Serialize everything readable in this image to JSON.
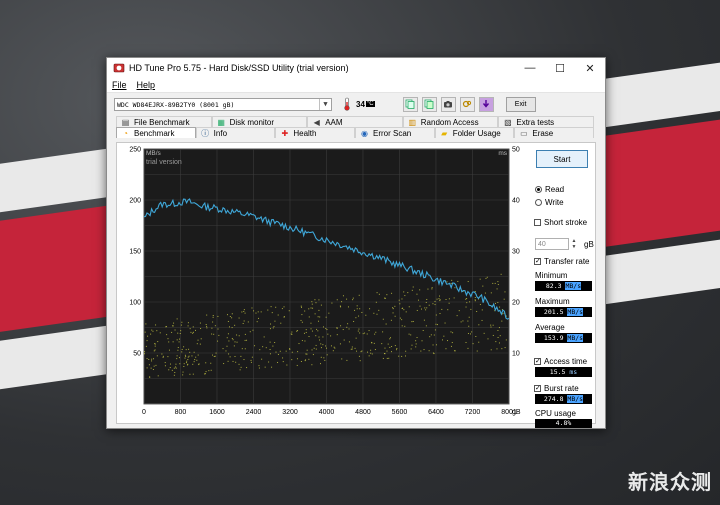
{
  "window": {
    "title": "HD Tune Pro 5.75 - Hard Disk/SSD Utility (trial version)",
    "controls": {
      "minimize": "—",
      "maximize": "☐",
      "close": "✕"
    }
  },
  "menu": {
    "file": "File",
    "help": "Help"
  },
  "toolbar": {
    "drive": "WDC WD84EJRX-89B2TY0 (8001 gB)",
    "temperature": "34",
    "temperature_unit": "°C",
    "exit_label": "Exit"
  },
  "tabs": {
    "row1": [
      {
        "label": "File Benchmark",
        "icon": "file-benchmark-icon"
      },
      {
        "label": "Disk monitor",
        "icon": "disk-monitor-icon"
      },
      {
        "label": "AAM",
        "icon": "speaker-icon"
      },
      {
        "label": "Random Access",
        "icon": "random-access-icon"
      },
      {
        "label": "Extra tests",
        "icon": "extra-tests-icon"
      }
    ],
    "row2": [
      {
        "label": "Benchmark",
        "icon": "benchmark-icon"
      },
      {
        "label": "Info",
        "icon": "info-icon"
      },
      {
        "label": "Health",
        "icon": "health-icon"
      },
      {
        "label": "Error Scan",
        "icon": "error-scan-icon"
      },
      {
        "label": "Folder Usage",
        "icon": "folder-icon"
      },
      {
        "label": "Erase",
        "icon": "erase-icon"
      }
    ],
    "active": "Benchmark"
  },
  "panel": {
    "start": "Start",
    "read": "Read",
    "write": "Write",
    "short_stroke": "Short stroke",
    "short_stroke_value": "40",
    "short_stroke_unit": "gB",
    "transfer_rate": "Transfer rate",
    "minimum_label": "Minimum",
    "minimum_value": "82.3",
    "maximum_label": "Maximum",
    "maximum_value": "201.5",
    "average_label": "Average",
    "average_value": "153.9",
    "rate_unit": "MB/s",
    "access_time_label": "Access time",
    "access_time_value": "15.5",
    "access_time_unit": "ms",
    "burst_rate_label": "Burst rate",
    "burst_rate_value": "274.8",
    "cpu_usage_label": "CPU usage",
    "cpu_usage_value": "4.8%"
  },
  "chart_data": {
    "type": "line",
    "overlay_text": "trial version",
    "y_left_label": "MB/s",
    "y_right_label": "ms",
    "x_unit": "gB",
    "y_left_ticks": [
      50,
      100,
      150,
      200,
      250
    ],
    "y_right_ticks": [
      10,
      20,
      30,
      40,
      50
    ],
    "x_ticks": [
      0,
      800,
      1600,
      2400,
      3200,
      4000,
      4800,
      5600,
      6400,
      7200,
      8001
    ],
    "ylim_left": [
      0,
      250
    ],
    "ylim_right": [
      0,
      50
    ],
    "xlim": [
      0,
      8001
    ],
    "series": [
      {
        "name": "Transfer rate",
        "color": "#3fa7d8",
        "x": [
          0,
          200,
          400,
          600,
          800,
          1000,
          1200,
          1400,
          1600,
          1800,
          2000,
          2200,
          2400,
          2600,
          2800,
          3000,
          3200,
          3400,
          3600,
          3800,
          4000,
          4200,
          4400,
          4600,
          4800,
          5000,
          5200,
          5400,
          5600,
          5800,
          6000,
          6200,
          6400,
          6600,
          6800,
          7000,
          7200,
          7400,
          7600,
          7800,
          8001
        ],
        "y": [
          182,
          190,
          196,
          196,
          198,
          198,
          195,
          193,
          192,
          190,
          188,
          186,
          184,
          181,
          178,
          176,
          173,
          170,
          167,
          164,
          161,
          158,
          155,
          152,
          149,
          146,
          143,
          139,
          136,
          133,
          129,
          126,
          122,
          119,
          115,
          111,
          108,
          104,
          97,
          91,
          84
        ]
      }
    ],
    "scatter": {
      "name": "Access time",
      "color": "#d8d84a",
      "unit": "ms",
      "range_ms_start": [
        5,
        16
      ],
      "range_ms_end": [
        11,
        26
      ]
    },
    "grid": true
  }
}
